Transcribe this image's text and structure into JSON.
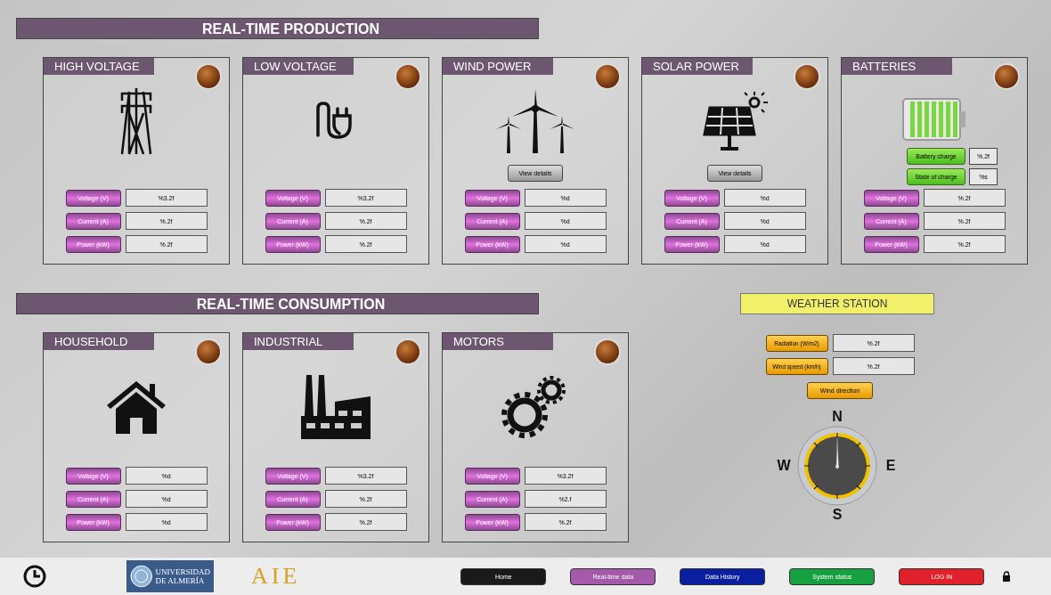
{
  "production": {
    "title": "REAL-TIME PRODUCTION",
    "panels": [
      {
        "title": "HIGH VOLTAGE",
        "kind": "tower",
        "readings": [
          {
            "label": "Voltage (V)",
            "value": "%3.2f"
          },
          {
            "label": "Current (A)",
            "value": "%.2f"
          },
          {
            "label": "Power (kW)",
            "value": "%.2f"
          }
        ]
      },
      {
        "title": "LOW VOLTAGE",
        "kind": "plug",
        "readings": [
          {
            "label": "Voltage (V)",
            "value": "%3.2f"
          },
          {
            "label": "Current (A)",
            "value": "%.2f"
          },
          {
            "label": "Power (kW)",
            "value": "%.2f"
          }
        ]
      },
      {
        "title": "WIND POWER",
        "kind": "wind",
        "details_button": "View details",
        "readings": [
          {
            "label": "Voltage (V)",
            "value": "%d"
          },
          {
            "label": "Current (A)",
            "value": "%d"
          },
          {
            "label": "Power (kW)",
            "value": "%d"
          }
        ]
      },
      {
        "title": "SOLAR POWER",
        "kind": "solar",
        "details_button": "View details",
        "readings": [
          {
            "label": "Voltage (V)",
            "value": "%d"
          },
          {
            "label": "Current (A)",
            "value": "%d"
          },
          {
            "label": "Power (kW)",
            "value": "%d"
          }
        ]
      },
      {
        "title": "BATTERIES",
        "kind": "battery",
        "charge": [
          {
            "label": "Battery charge",
            "value": "%.2f"
          },
          {
            "label": "State of charge",
            "value": "%s"
          }
        ],
        "readings": [
          {
            "label": "Voltage (V)",
            "value": "%.2f"
          },
          {
            "label": "Current (A)",
            "value": "%.2f"
          },
          {
            "label": "Power (kW)",
            "value": "%.2f"
          }
        ]
      }
    ]
  },
  "consumption": {
    "title": "REAL-TIME CONSUMPTION",
    "panels": [
      {
        "title": "HOUSEHOLD",
        "kind": "house",
        "readings": [
          {
            "label": "Voltage (V)",
            "value": "%d"
          },
          {
            "label": "Current (A)",
            "value": "%d"
          },
          {
            "label": "Power (kW)",
            "value": "%d"
          }
        ]
      },
      {
        "title": "INDUSTRIAL",
        "kind": "factory",
        "readings": [
          {
            "label": "Voltage (V)",
            "value": "%3.2f"
          },
          {
            "label": "Current (A)",
            "value": "%.2f"
          },
          {
            "label": "Power (kW)",
            "value": "%.2f"
          }
        ]
      },
      {
        "title": "MOTORS",
        "kind": "gears",
        "readings": [
          {
            "label": "Voltage (V)",
            "value": "%3.2f"
          },
          {
            "label": "Current (A)",
            "value": "%2.f"
          },
          {
            "label": "Power (kW)",
            "value": "%.2f"
          }
        ]
      }
    ]
  },
  "weather_station": {
    "title": "WEATHER STATION",
    "readings": [
      {
        "label": "Radiation (W/m2)",
        "value": "%.2f"
      },
      {
        "label": "Wind speed (km/h)",
        "value": "%.2f"
      }
    ],
    "wind_direction_button": "Wind direction",
    "compass": {
      "north": "N",
      "west": "W",
      "east": "E",
      "south": "S"
    }
  },
  "footer": {
    "university_logo": [
      "UNIVERSIDAD",
      "DE ALMERÍA"
    ],
    "aie_logo": "AIE",
    "nav": [
      {
        "label": "Home",
        "color": "#1a1a1a"
      },
      {
        "label": "Real-time data",
        "color": "#a45aa8"
      },
      {
        "label": "Data History",
        "color": "#0a1fa0"
      },
      {
        "label": "System status",
        "color": "#16a040"
      },
      {
        "label": "LOG IN",
        "color": "#e0202a"
      }
    ]
  }
}
